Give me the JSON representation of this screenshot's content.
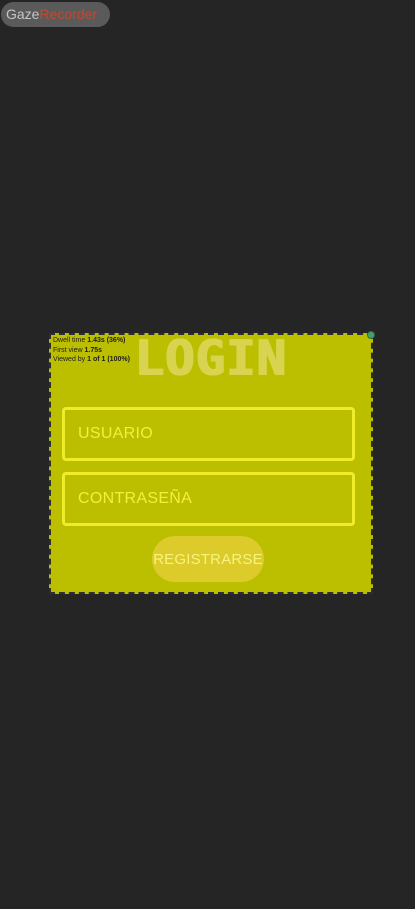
{
  "overlay": {
    "brand_part1": "Gaze",
    "brand_part2": "Recorder",
    "stats": {
      "dwell_label": "Dwell time",
      "dwell_value": "1.43s (36%)",
      "first_view_label": "First view",
      "first_view_value": "1.75s",
      "viewed_by_label": "Viewed by",
      "viewed_by_value": "1 of 1 (100%)"
    }
  },
  "form": {
    "title": "LOGIN",
    "username_placeholder": "USUARIO",
    "password_placeholder": "CONTRASEÑA",
    "register_label": "REGISTRARSE"
  },
  "colors": {
    "background": "#252525",
    "panel": "#bcbf00",
    "field_border": "#f0ec2a",
    "button": "#dccb2a",
    "brand_accent": "#c7472d"
  }
}
